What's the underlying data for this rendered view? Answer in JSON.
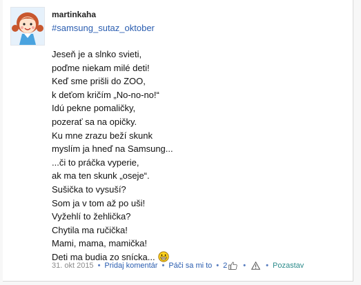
{
  "post": {
    "author": "martinkaha",
    "hashtag": "#samsung_sutaz_oktober",
    "poem_lines": [
      "Jeseň je a slnko svieti,",
      "poďme niekam milé deti!",
      "Keď sme prišli do ZOO,",
      "k deťom kričím „No-no-no!“",
      "Idú pekne pomaličky,",
      "pozerať sa na opičky.",
      "Ku mne zrazu beží skunk",
      "myslím ja hneď na Samsung...",
      "...či to práčka vyperie,",
      "ak ma ten skunk „oseje“.",
      "Sušička to vysuší?",
      "Som ja v tom až po uši!",
      "Vyžehlí to žehlička?",
      "Chytila ma ručička!",
      "Mami, mama, mamička!",
      "Deti ma budia zo snícka..."
    ],
    "emoji_icon": "grinning-face-icon"
  },
  "footer": {
    "date": "31. okt 2015",
    "comment_label": "Pridaj komentár",
    "like_label": "Páči sa mi to",
    "like_count": "2",
    "like_icon": "thumbs-up-icon",
    "report_icon": "warning-icon",
    "background_label": "Pozastav"
  }
}
